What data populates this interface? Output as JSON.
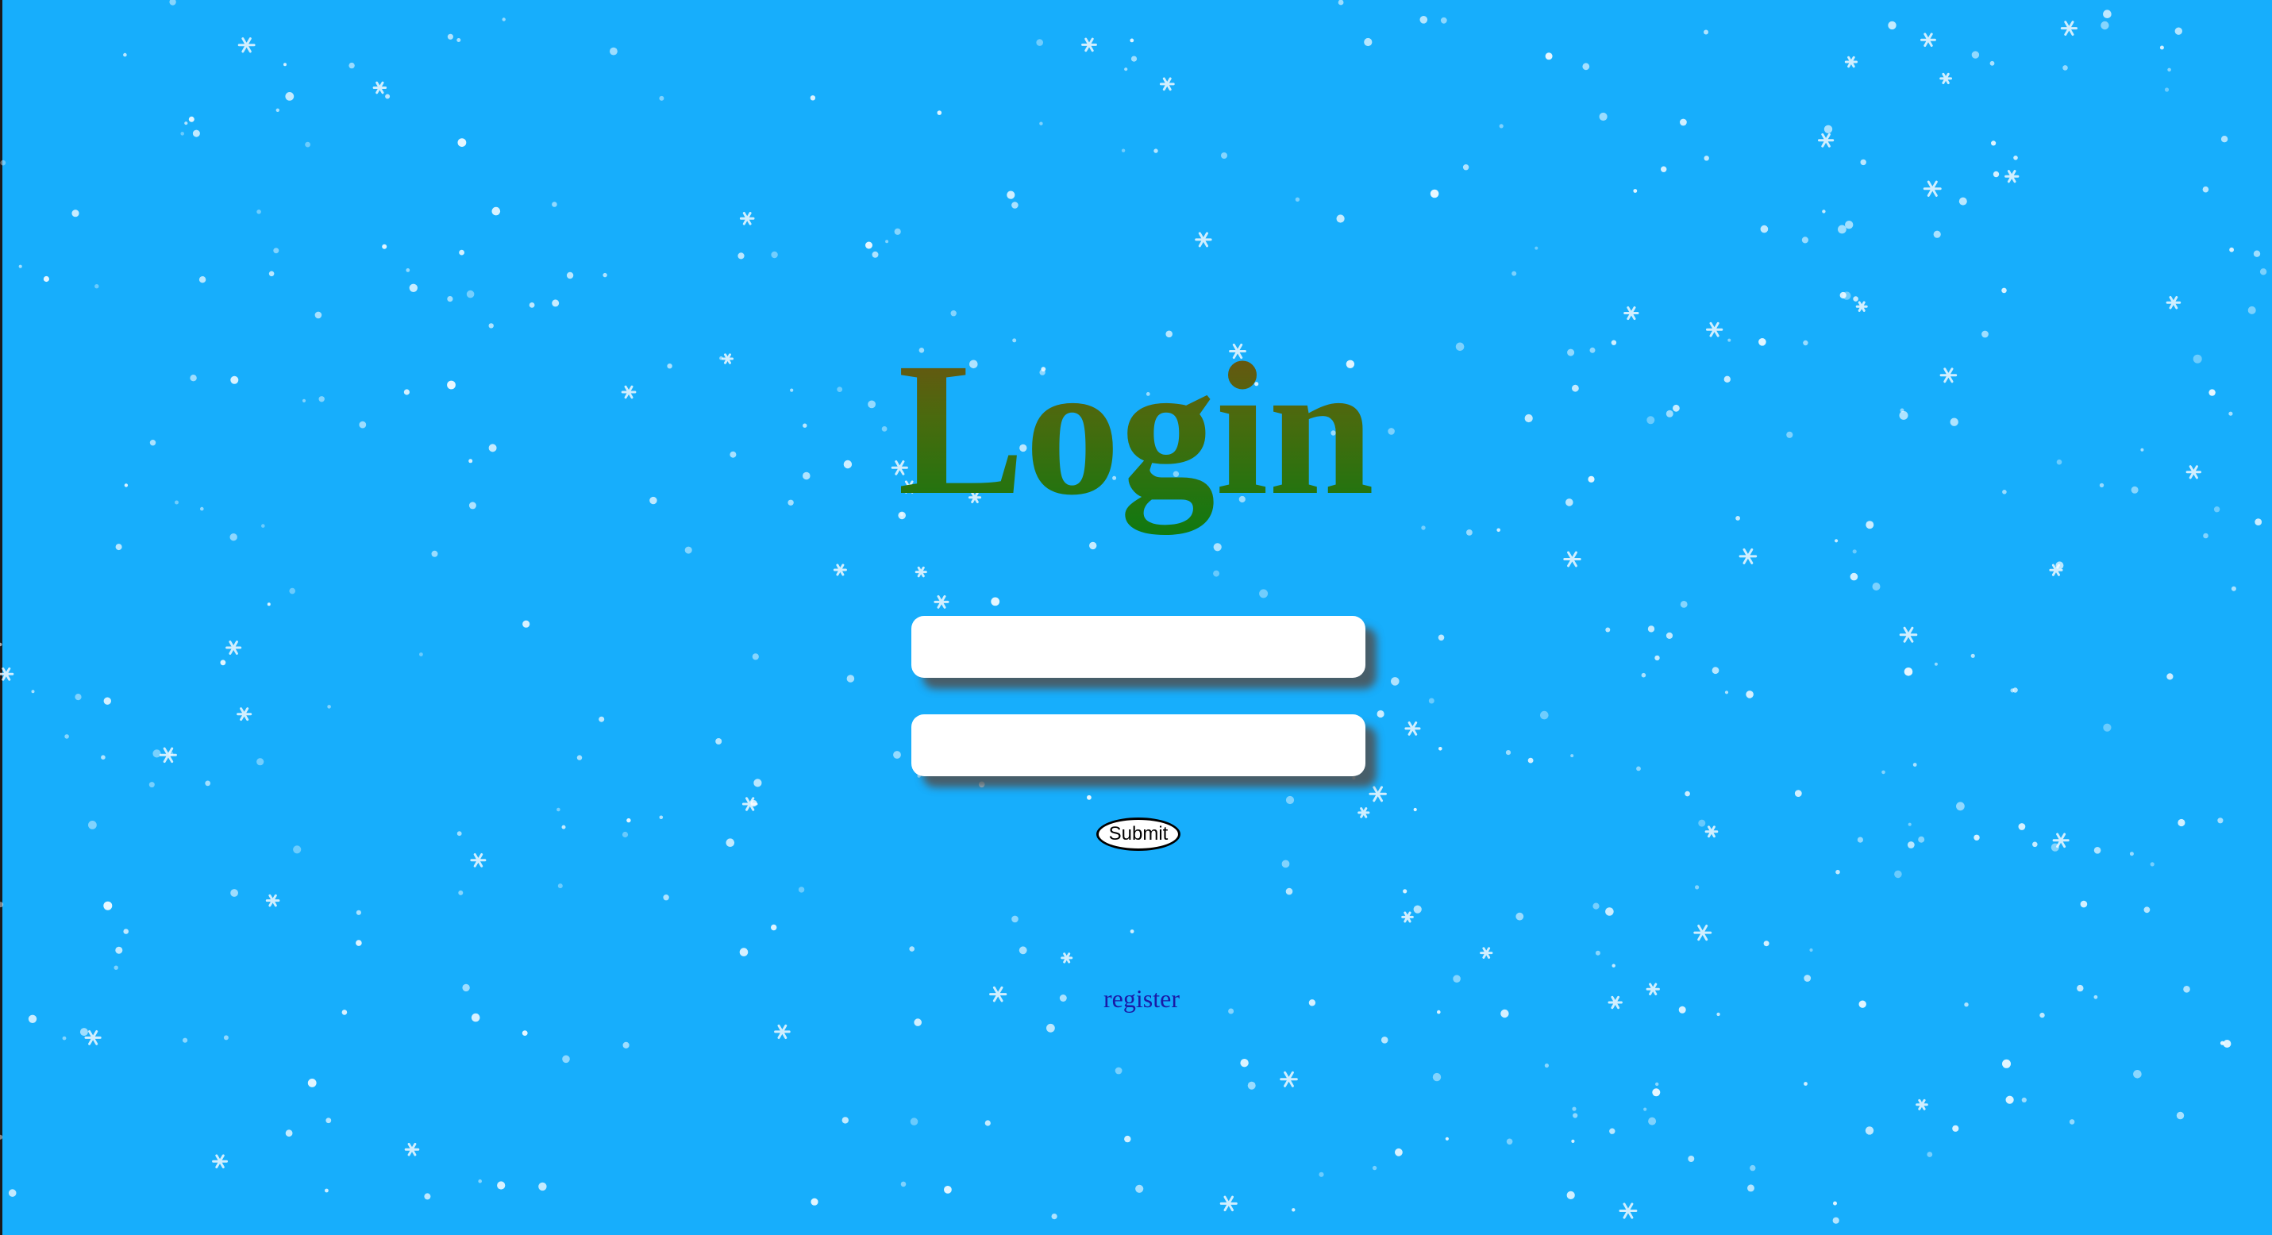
{
  "page": {
    "title": "Login",
    "background_color": "#17aefc"
  },
  "form": {
    "username_value": "",
    "password_value": "",
    "submit_label": "Submit"
  },
  "links": {
    "register_label": "register"
  },
  "decoration": {
    "background_icon": "snowflake-icon"
  }
}
